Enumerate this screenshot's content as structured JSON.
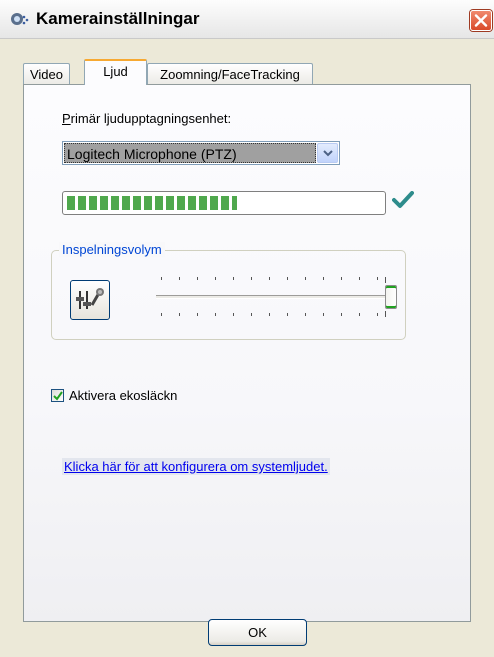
{
  "window": {
    "title": "Kamerainställningar",
    "icon": "webcam-settings-icon",
    "close_icon": "close-icon"
  },
  "tabs": [
    {
      "label": "Video",
      "selected": false
    },
    {
      "label": "Ljud",
      "selected": true
    },
    {
      "label": "Zoomning/FaceTracking",
      "selected": false
    }
  ],
  "audio": {
    "device_label_first": "P",
    "device_label_rest": "rimär ljudupptagningsenhet:",
    "device_selected": "Logitech Microphone (PTZ)",
    "level_fraction": 0.54,
    "level_ok_icon": "checkmark-icon",
    "recording_volume": {
      "label": "Inspelningsvolym",
      "mixer_icon": "mixer-mic-icon",
      "slider_value_fraction": 1.0
    },
    "echo_cancel": {
      "label": "Aktivera ekosläckn",
      "checked": true
    },
    "system_audio_link": "Klicka här för att konfigurera om systemljudet."
  },
  "footer": {
    "ok_label": "OK"
  },
  "colors": {
    "accent_tab": "#f7a932",
    "group_label": "#0046d5",
    "level_green": "#4fa84d",
    "close_red": "#d94a2a"
  }
}
